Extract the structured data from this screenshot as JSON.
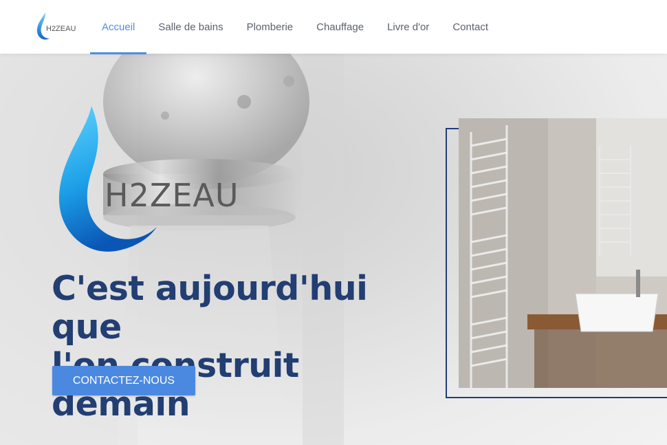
{
  "header": {
    "logo_text": "H2ZEAU",
    "nav": [
      {
        "label": "Accueil",
        "active": true
      },
      {
        "label": "Salle de bains",
        "active": false
      },
      {
        "label": "Plomberie",
        "active": false
      },
      {
        "label": "Chauffage",
        "active": false
      },
      {
        "label": "Livre d'or",
        "active": false
      },
      {
        "label": "Contact",
        "active": false
      }
    ]
  },
  "hero": {
    "logo_text": "H2ZEAU",
    "headline_line1": "C'est aujourd'hui que",
    "headline_line2": "l'on construit demain",
    "cta_label": "CONTACTEZ-NOUS"
  },
  "colors": {
    "accent": "#4a8fe3",
    "headline": "#223e72",
    "frame": "#1f3d77",
    "nav_text": "#5b6170"
  }
}
